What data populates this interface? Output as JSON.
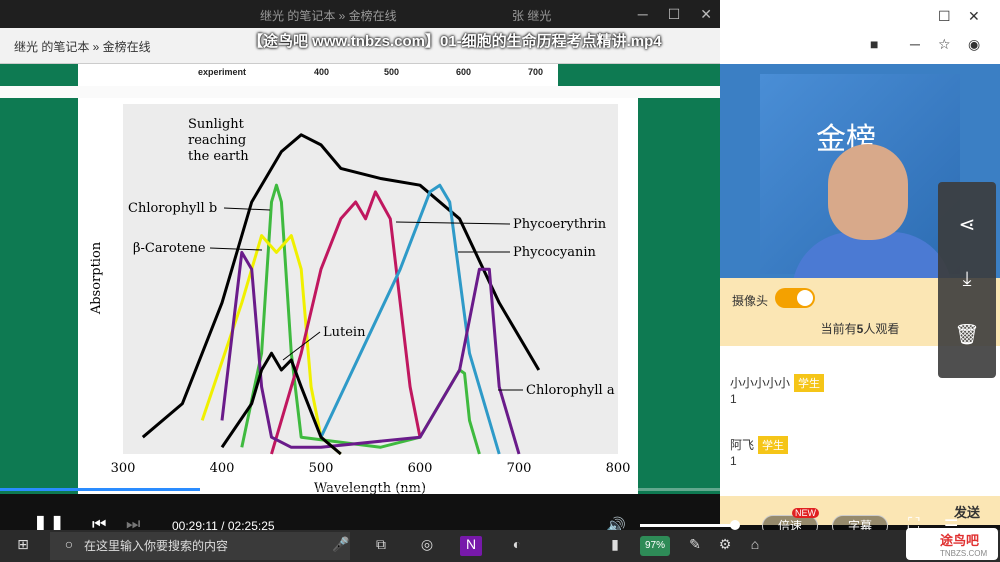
{
  "window": {
    "bg_title_left": "继光 的笔记本 » 金榜在线",
    "bg_title_right": "张 继光",
    "video_title": "【途鸟吧 www.tnbzs.com】01-细胞的生命历程考点精讲.mp4"
  },
  "notebook": {
    "breadcrumb": "继光 的笔记本 » 金榜在线"
  },
  "slide": {
    "top_strip": {
      "label": "experiment",
      "ticks": [
        "400",
        "500",
        "600",
        "700"
      ]
    }
  },
  "chart_data": {
    "type": "line",
    "xlabel": "Wavelength (nm)",
    "ylabel": "Absorption",
    "xlim": [
      300,
      800
    ],
    "xticks": [
      "300",
      "400",
      "500",
      "600",
      "700",
      "800"
    ],
    "labels": {
      "sunlight": [
        "Sunlight",
        "reaching",
        "the earth"
      ],
      "chl_b": "Chlorophyll b",
      "carotene": "β-Carotene",
      "lutein": "Lutein",
      "phycoerythrin": "Phycoerythrin",
      "phycocyanin": "Phycocyanin",
      "chl_a": "Chlorophyll a"
    },
    "series": [
      {
        "key": "sunlight",
        "color": "#000000",
        "x": [
          320,
          360,
          400,
          430,
          460,
          480,
          500,
          520,
          560,
          600,
          640,
          680,
          720
        ],
        "y": [
          0.05,
          0.15,
          0.45,
          0.75,
          0.9,
          0.95,
          0.92,
          0.85,
          0.82,
          0.8,
          0.7,
          0.45,
          0.25
        ]
      },
      {
        "key": "chl_b",
        "color": "#3fba3f",
        "x": [
          420,
          440,
          450,
          455,
          460,
          470,
          480,
          560,
          600,
          640,
          645,
          650,
          660
        ],
        "y": [
          0.02,
          0.3,
          0.75,
          0.8,
          0.75,
          0.3,
          0.05,
          0.02,
          0.05,
          0.25,
          0.24,
          0.1,
          0.0
        ]
      },
      {
        "key": "carotene",
        "color": "#f0f000",
        "x": [
          380,
          420,
          440,
          455,
          470,
          480,
          490,
          500,
          520
        ],
        "y": [
          0.1,
          0.45,
          0.65,
          0.6,
          0.65,
          0.55,
          0.2,
          0.05,
          0.0
        ]
      },
      {
        "key": "phycoerythrin",
        "color": "#c0175f",
        "x": [
          450,
          480,
          500,
          520,
          535,
          545,
          555,
          570,
          590,
          600
        ],
        "y": [
          0.0,
          0.3,
          0.55,
          0.7,
          0.75,
          0.7,
          0.78,
          0.7,
          0.2,
          0.05
        ]
      },
      {
        "key": "phycocyanin",
        "color": "#2e9ac8",
        "x": [
          500,
          540,
          580,
          610,
          620,
          630,
          650,
          680
        ],
        "y": [
          0.05,
          0.3,
          0.55,
          0.78,
          0.8,
          0.75,
          0.3,
          0.0
        ]
      },
      {
        "key": "chl_a",
        "color": "#6a1b8a",
        "x": [
          400,
          420,
          430,
          440,
          450,
          470,
          500,
          600,
          640,
          660,
          670,
          680,
          700
        ],
        "y": [
          0.1,
          0.6,
          0.55,
          0.2,
          0.05,
          0.02,
          0.02,
          0.05,
          0.25,
          0.55,
          0.55,
          0.2,
          0.0
        ]
      },
      {
        "key": "lutein",
        "color": "#000000",
        "x": [
          400,
          430,
          440,
          450,
          460,
          470,
          480,
          500,
          520
        ],
        "y": [
          0.02,
          0.15,
          0.25,
          0.3,
          0.25,
          0.28,
          0.2,
          0.05,
          0.0
        ]
      }
    ]
  },
  "right_panel": {
    "camera_label": "摄像头",
    "camera_on": true,
    "viewers_prefix": "当前有",
    "viewers_count": "5",
    "viewers_suffix": "人观看",
    "messages": [
      {
        "user": "小小小小小",
        "badge": "学生",
        "text": "1"
      },
      {
        "user": "阿飞",
        "badge": "学生",
        "text": "1"
      }
    ],
    "send_label": "发送"
  },
  "player": {
    "current_time": "00:29:11",
    "total_time": "02:25:25",
    "progress": 0.2,
    "speed_label": "倍速",
    "new_badge": "NEW",
    "subtitle_label": "字幕"
  },
  "taskbar": {
    "search_placeholder": "在这里输入你要搜索的内容",
    "battery": "97%"
  },
  "watermark": {
    "text": "途鸟吧",
    "url": "TNBZS.COM"
  }
}
